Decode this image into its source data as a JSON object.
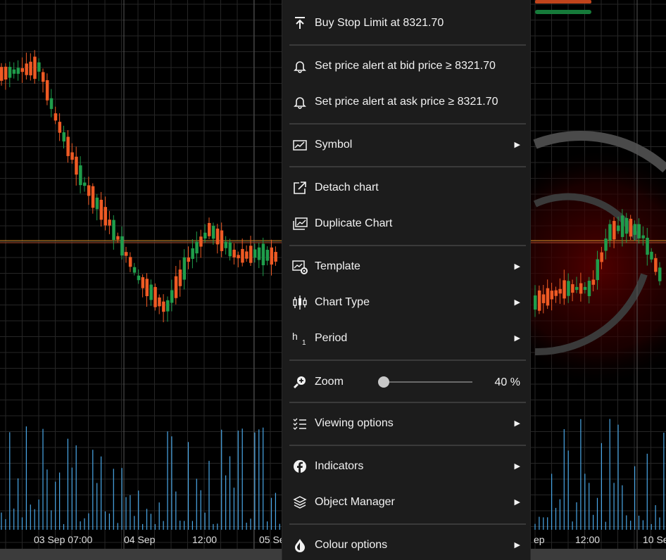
{
  "menu": {
    "buy_stop_limit": "Buy Stop Limit at 8321.70",
    "alert_bid": "Set price alert at bid price ≥ 8321.70",
    "alert_ask": "Set price alert at ask price ≥ 8321.70",
    "symbol": "Symbol",
    "detach_chart": "Detach chart",
    "duplicate_chart": "Duplicate Chart",
    "template": "Template",
    "chart_type": "Chart Type",
    "period_icon_main": "h",
    "period_icon_sub": "1",
    "period": "Period",
    "zoom": "Zoom",
    "zoom_value": "40 %",
    "zoom_level": 0.0,
    "viewing_options": "Viewing options",
    "indicators": "Indicators",
    "object_manager": "Object Manager",
    "colour_options": "Colour options",
    "submenu_arrow": "▶"
  },
  "xaxis": {
    "labels": [
      "03 Sep 07:00",
      "04 Sep",
      "12:00",
      "05 Se",
      "ep",
      "12:00",
      "10 Se"
    ]
  },
  "colors": {
    "up": "#1f9d4b",
    "down": "#ee5a24",
    "volume": "#4aa8e8",
    "price_line": "#d8922a"
  },
  "icons": [
    "upload-icon",
    "bell-icon",
    "bell-icon",
    "line-chart-icon",
    "external-link-icon",
    "duplicate-chart-icon",
    "template-gear-icon",
    "candlestick-icon",
    "period-icon",
    "zoom-in-icon",
    "checklist-icon",
    "facebook-icon",
    "layers-icon",
    "paint-drop-icon"
  ]
}
